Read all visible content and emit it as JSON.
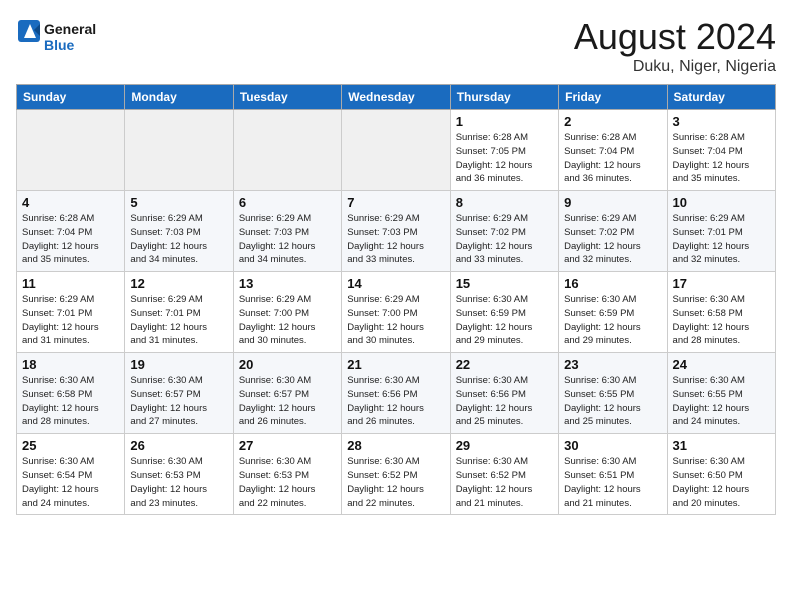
{
  "header": {
    "logo_line1": "General",
    "logo_line2": "Blue",
    "month_year": "August 2024",
    "location": "Duku, Niger, Nigeria"
  },
  "weekdays": [
    "Sunday",
    "Monday",
    "Tuesday",
    "Wednesday",
    "Thursday",
    "Friday",
    "Saturday"
  ],
  "weeks": [
    [
      {
        "num": "",
        "info": ""
      },
      {
        "num": "",
        "info": ""
      },
      {
        "num": "",
        "info": ""
      },
      {
        "num": "",
        "info": ""
      },
      {
        "num": "1",
        "info": "Sunrise: 6:28 AM\nSunset: 7:05 PM\nDaylight: 12 hours\nand 36 minutes."
      },
      {
        "num": "2",
        "info": "Sunrise: 6:28 AM\nSunset: 7:04 PM\nDaylight: 12 hours\nand 36 minutes."
      },
      {
        "num": "3",
        "info": "Sunrise: 6:28 AM\nSunset: 7:04 PM\nDaylight: 12 hours\nand 35 minutes."
      }
    ],
    [
      {
        "num": "4",
        "info": "Sunrise: 6:28 AM\nSunset: 7:04 PM\nDaylight: 12 hours\nand 35 minutes."
      },
      {
        "num": "5",
        "info": "Sunrise: 6:29 AM\nSunset: 7:03 PM\nDaylight: 12 hours\nand 34 minutes."
      },
      {
        "num": "6",
        "info": "Sunrise: 6:29 AM\nSunset: 7:03 PM\nDaylight: 12 hours\nand 34 minutes."
      },
      {
        "num": "7",
        "info": "Sunrise: 6:29 AM\nSunset: 7:03 PM\nDaylight: 12 hours\nand 33 minutes."
      },
      {
        "num": "8",
        "info": "Sunrise: 6:29 AM\nSunset: 7:02 PM\nDaylight: 12 hours\nand 33 minutes."
      },
      {
        "num": "9",
        "info": "Sunrise: 6:29 AM\nSunset: 7:02 PM\nDaylight: 12 hours\nand 32 minutes."
      },
      {
        "num": "10",
        "info": "Sunrise: 6:29 AM\nSunset: 7:01 PM\nDaylight: 12 hours\nand 32 minutes."
      }
    ],
    [
      {
        "num": "11",
        "info": "Sunrise: 6:29 AM\nSunset: 7:01 PM\nDaylight: 12 hours\nand 31 minutes."
      },
      {
        "num": "12",
        "info": "Sunrise: 6:29 AM\nSunset: 7:01 PM\nDaylight: 12 hours\nand 31 minutes."
      },
      {
        "num": "13",
        "info": "Sunrise: 6:29 AM\nSunset: 7:00 PM\nDaylight: 12 hours\nand 30 minutes."
      },
      {
        "num": "14",
        "info": "Sunrise: 6:29 AM\nSunset: 7:00 PM\nDaylight: 12 hours\nand 30 minutes."
      },
      {
        "num": "15",
        "info": "Sunrise: 6:30 AM\nSunset: 6:59 PM\nDaylight: 12 hours\nand 29 minutes."
      },
      {
        "num": "16",
        "info": "Sunrise: 6:30 AM\nSunset: 6:59 PM\nDaylight: 12 hours\nand 29 minutes."
      },
      {
        "num": "17",
        "info": "Sunrise: 6:30 AM\nSunset: 6:58 PM\nDaylight: 12 hours\nand 28 minutes."
      }
    ],
    [
      {
        "num": "18",
        "info": "Sunrise: 6:30 AM\nSunset: 6:58 PM\nDaylight: 12 hours\nand 28 minutes."
      },
      {
        "num": "19",
        "info": "Sunrise: 6:30 AM\nSunset: 6:57 PM\nDaylight: 12 hours\nand 27 minutes."
      },
      {
        "num": "20",
        "info": "Sunrise: 6:30 AM\nSunset: 6:57 PM\nDaylight: 12 hours\nand 26 minutes."
      },
      {
        "num": "21",
        "info": "Sunrise: 6:30 AM\nSunset: 6:56 PM\nDaylight: 12 hours\nand 26 minutes."
      },
      {
        "num": "22",
        "info": "Sunrise: 6:30 AM\nSunset: 6:56 PM\nDaylight: 12 hours\nand 25 minutes."
      },
      {
        "num": "23",
        "info": "Sunrise: 6:30 AM\nSunset: 6:55 PM\nDaylight: 12 hours\nand 25 minutes."
      },
      {
        "num": "24",
        "info": "Sunrise: 6:30 AM\nSunset: 6:55 PM\nDaylight: 12 hours\nand 24 minutes."
      }
    ],
    [
      {
        "num": "25",
        "info": "Sunrise: 6:30 AM\nSunset: 6:54 PM\nDaylight: 12 hours\nand 24 minutes."
      },
      {
        "num": "26",
        "info": "Sunrise: 6:30 AM\nSunset: 6:53 PM\nDaylight: 12 hours\nand 23 minutes."
      },
      {
        "num": "27",
        "info": "Sunrise: 6:30 AM\nSunset: 6:53 PM\nDaylight: 12 hours\nand 22 minutes."
      },
      {
        "num": "28",
        "info": "Sunrise: 6:30 AM\nSunset: 6:52 PM\nDaylight: 12 hours\nand 22 minutes."
      },
      {
        "num": "29",
        "info": "Sunrise: 6:30 AM\nSunset: 6:52 PM\nDaylight: 12 hours\nand 21 minutes."
      },
      {
        "num": "30",
        "info": "Sunrise: 6:30 AM\nSunset: 6:51 PM\nDaylight: 12 hours\nand 21 minutes."
      },
      {
        "num": "31",
        "info": "Sunrise: 6:30 AM\nSunset: 6:50 PM\nDaylight: 12 hours\nand 20 minutes."
      }
    ]
  ]
}
